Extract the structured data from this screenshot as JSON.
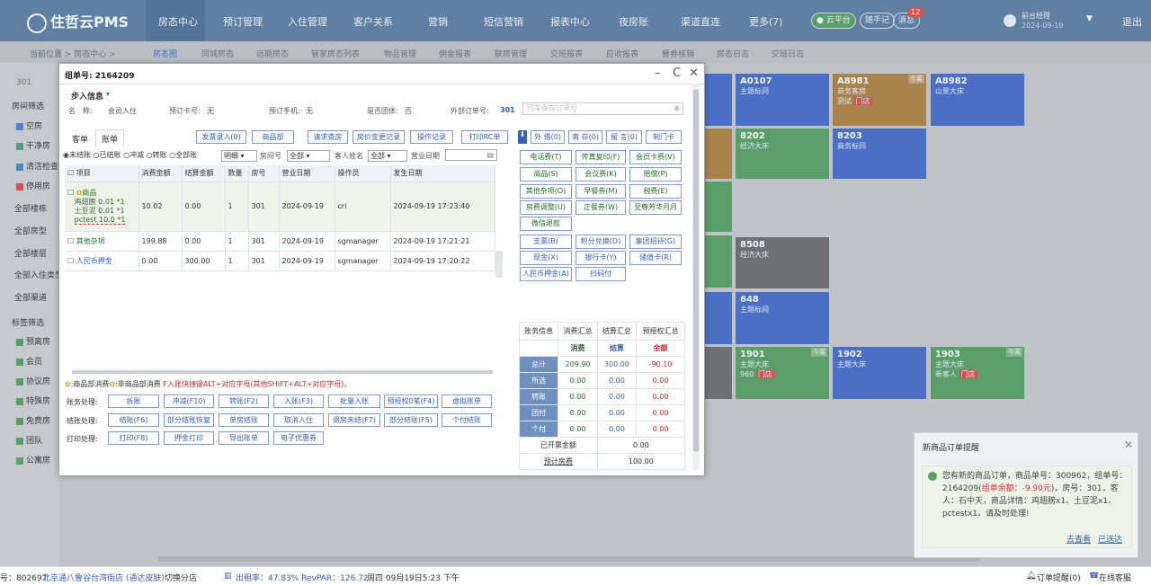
{
  "app": {
    "name": "住哲云PMS"
  },
  "nav": {
    "items": [
      "房态中心",
      "预订管理",
      "入住管理",
      "客户关系",
      "营销",
      "短信营销",
      "报表中心",
      "夜房账",
      "渠道直连",
      "更多(7)"
    ],
    "cloud_label": "云平台",
    "notes_label": "随手记",
    "msg_label": "消息",
    "msg_count": "12",
    "user_name": "前台经理",
    "user_date": "2024-09-19",
    "logout": "退出"
  },
  "breadcrumb": "当前位置 > 房态中心 >",
  "subnav": [
    "房态图",
    "同城房态",
    "远期房态",
    "管家房态列表",
    "物品管理",
    "佣金报表",
    "联房管理",
    "交班报表",
    "应收报表",
    "餐券核销",
    "房态日志",
    "交班日志"
  ],
  "sidebar": {
    "top": "301",
    "section1": "房间筛选",
    "statuses": [
      {
        "label": "空房",
        "color": "#5b7fd0"
      },
      {
        "label": "干净房",
        "color": "#5a9a8a"
      },
      {
        "label": "清洁检查",
        "color": "#4f86b8"
      },
      {
        "label": "停用房",
        "color": "#c55"
      }
    ],
    "filters": [
      "全部楼栋",
      "全部房型",
      "全部楼层",
      "全部入住类型",
      "全部渠道"
    ],
    "section2": "标签筛选",
    "tags": [
      "预离房",
      "会员",
      "协议房",
      "特殊房",
      "免费房",
      "团队",
      "公寓房"
    ]
  },
  "rooms": [
    {
      "num": "A0107",
      "type": "主题标间",
      "color": "#4a6fc4"
    },
    {
      "num": "A8981",
      "type": "商务客房",
      "color": "#a8844c",
      "tag": "今离",
      "guest": "测试",
      "extra": "门店"
    },
    {
      "num": "A8982",
      "type": "山景大床",
      "color": "#4a6fc4"
    },
    {
      "num": "8202",
      "type": "经济大床",
      "color": "#5a9e6a",
      "tag": "今离"
    },
    {
      "num": "8203",
      "type": "商务标间",
      "color": "#4a6fc4"
    },
    {
      "num": "8508",
      "type": "经济大床",
      "color": "#6e7074"
    },
    {
      "num": "648",
      "type": "主题标间",
      "color": "#4a6fc4"
    },
    {
      "num": "1901",
      "type": "主题大床",
      "color": "#5a9e6a",
      "tag": "今离",
      "guest": "960",
      "extra": "门店"
    },
    {
      "num": "1902",
      "type": "主题大床",
      "color": "#4a6fc4"
    },
    {
      "num": "1903",
      "type": "主题大床",
      "color": "#5a9e6a",
      "tag": "今离",
      "guest": "新客人",
      "extra": "门店"
    }
  ],
  "modal": {
    "title": "组单号: 2164209",
    "section": "步入信息",
    "info": {
      "name_label": "名　称:",
      "name": "会员入住",
      "card_label": "预订卡号:",
      "card": "无",
      "phone_label": "预订手机:",
      "phone": "无",
      "group_label": "是否团体:",
      "group": "否",
      "ext_label": "外部订单号:",
      "ext": "301",
      "ext_placeholder": "回车保存订单号"
    },
    "tabs": [
      "客单",
      "账单"
    ],
    "toolbar": [
      "发票录入(0)",
      "商品部",
      "请求查房",
      "房价变更记录",
      "操作记录",
      "打印RC单"
    ],
    "toolbar2": [
      "外 借(0)",
      "寄 存(0)",
      "留 言(0)",
      "制门卡"
    ],
    "filter": {
      "radios": [
        "未结账",
        "已结账",
        "冲减",
        "转账",
        "全部账"
      ],
      "mode": "明细",
      "room_label": "房间号",
      "room": "全部",
      "guest_label": "客人姓名",
      "guest": "全部",
      "date_label": "营业日期"
    },
    "columns": [
      "项目",
      "消费金额",
      "结算金额",
      "数量",
      "房号",
      "营业日期",
      "操作员",
      "发生日期"
    ],
    "rows": [
      {
        "item": "商品",
        "sub": [
          "鸡翅膀 0.01 *1",
          "土豆泥 0.01 *1",
          "pctest 10.0 *1"
        ],
        "amount": "10.02",
        "settle": "0.00",
        "qty": "1",
        "room": "301",
        "date": "2024-09-19",
        "op": "cri",
        "time": "2024-09-19 17:23:40"
      },
      {
        "item": "其他杂项",
        "amount": "199.88",
        "settle": "0.00",
        "qty": "1",
        "room": "301",
        "date": "2024-09-19",
        "op": "sgmanager",
        "time": "2024-09-19 17:21:21"
      },
      {
        "item": "人民币押金",
        "amount": "0.00",
        "settle": "300.00",
        "qty": "1",
        "room": "301",
        "date": "2024-09-19",
        "op": "sgmanager",
        "time": "2024-09-19 17:20:22"
      }
    ],
    "note_prefix": ":商品部消费",
    "note_mid": ":非商品部消费",
    "note_red": "F入账快捷键ALT+对应字母(其他SHIFT+ALT+对应字母)。",
    "actions": {
      "row1_label": "账务处理:",
      "row1": [
        "拆账",
        "冲减(F10)",
        "转账(F2)",
        "入账(F3)",
        "批量入账",
        "预授权0笔(F4)",
        "虚拟账单"
      ],
      "row2_label": "结账处理:",
      "row2": [
        "结账(F6)",
        "部分结账恢复",
        "单房结账",
        "取消入住",
        "退房未结(F7)",
        "部分结账(F5)",
        "个付结账"
      ],
      "row3_label": "打印处理:",
      "row3": [
        "打印(F8)",
        "押金打印",
        "导出账单",
        "电子优惠券"
      ]
    },
    "charges": [
      [
        "电话费(T)",
        "传真复印(F)",
        "会员卡费(V)"
      ],
      [
        "商品(S)",
        "会议费(K)",
        "赔偿(P)"
      ],
      [
        "其他杂项(O)",
        "早餐券(M)",
        "税费(E)"
      ],
      [
        "房费调整(U)",
        "正餐券(W)",
        "至尊芳华月月"
      ],
      [
        "微信退款"
      ]
    ],
    "payments": [
      [
        "支票(B)",
        "积分兑换(D)",
        "集团招待(G)"
      ],
      [
        "现金(X)",
        "银行卡(Y)",
        "储值卡(R)"
      ],
      [
        "人民币押金(A)",
        "扫码付"
      ]
    ],
    "summary": {
      "tabs": [
        "账务信息",
        "消费汇总",
        "结算汇总",
        "预授权汇总"
      ],
      "headers": [
        "消费",
        "结算",
        "余额"
      ],
      "rows": [
        {
          "label": "总计",
          "c": "209.90",
          "s": "300.00",
          "b": "-90.10"
        },
        {
          "label": "所选",
          "c": "0.00",
          "s": "0.00",
          "b": "0.00"
        },
        {
          "label": "转账",
          "c": "0.00",
          "s": "0.00",
          "b": "0.00"
        },
        {
          "label": "团付",
          "c": "0.00",
          "s": "0.00",
          "b": "0.00"
        },
        {
          "label": "个付",
          "c": "0.00",
          "s": "0.00",
          "b": "0.00"
        }
      ],
      "invoice_label": "已开票金额",
      "invoice": "0.00",
      "forecast_label": "预计房费",
      "forecast": "100.00"
    }
  },
  "popup": {
    "title": "新商品订单提醒",
    "text1": "您有新的商品订单，商品单号：300962，组单号：2164209(",
    "text_red": "组单余额：-9.90元",
    "text2": ")，房号：301，客人：石中天，商品详情：鸡翅膀x1、土豆泥x1、pctestx1，请及时处理!",
    "link1": "去查看",
    "link2": "已送达"
  },
  "statusbar": {
    "left": "号：802697",
    "hotel": "北京通八鲁谷台湾街店 (通达皮肤)",
    "switch": "切换分店",
    "occupancy": "出租率：47.83% RevPAR：126.72",
    "datetime": "周四 09月19日5:23 下午",
    "orders": "订单提醒(0)",
    "service": "在线客服"
  }
}
